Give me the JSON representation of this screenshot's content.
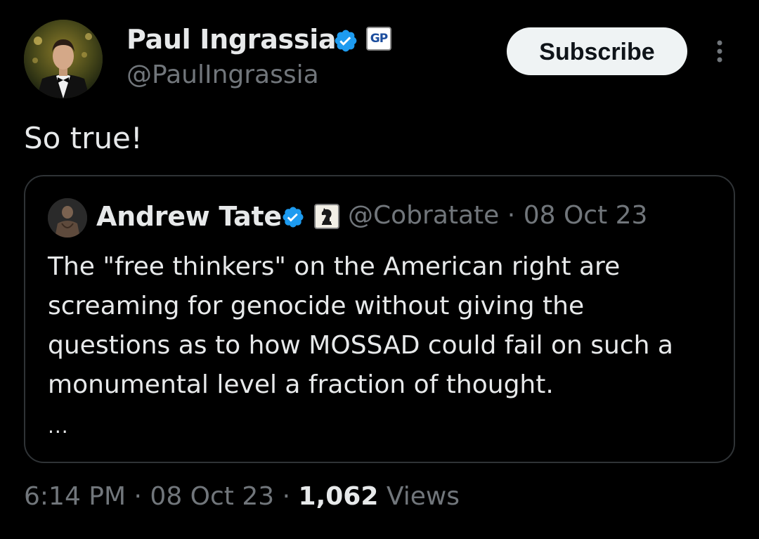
{
  "author": {
    "display_name": "Paul Ingrassia",
    "handle": "@PaulIngrassia",
    "affiliation_badge": "GP",
    "verified": true,
    "avatar": "profile-photo"
  },
  "actions": {
    "subscribe_label": "Subscribe",
    "more_icon": "more-vertical-icon"
  },
  "tweet": {
    "text": "So true!"
  },
  "quote": {
    "display_name": "Andrew Tate",
    "verified": true,
    "affiliation_icon": "chess-knight-badge-icon",
    "handle": "@Cobratate",
    "separator": "·",
    "date": "08 Oct 23",
    "body": "The \"free thinkers\" on the American right are screaming for genocide without giving the questions as to how MOSSAD could fail on such a monumental level a fraction of thought.",
    "ellipsis": "..."
  },
  "meta": {
    "time": "6:14 PM",
    "separator": "·",
    "date": "08 Oct 23",
    "views_count": "1,062",
    "views_label": "Views"
  },
  "colors": {
    "background": "#000000",
    "text_primary": "#e7e9ea",
    "text_secondary": "#71767b",
    "verified_blue": "#1d9bf0",
    "border": "#2f3336"
  }
}
